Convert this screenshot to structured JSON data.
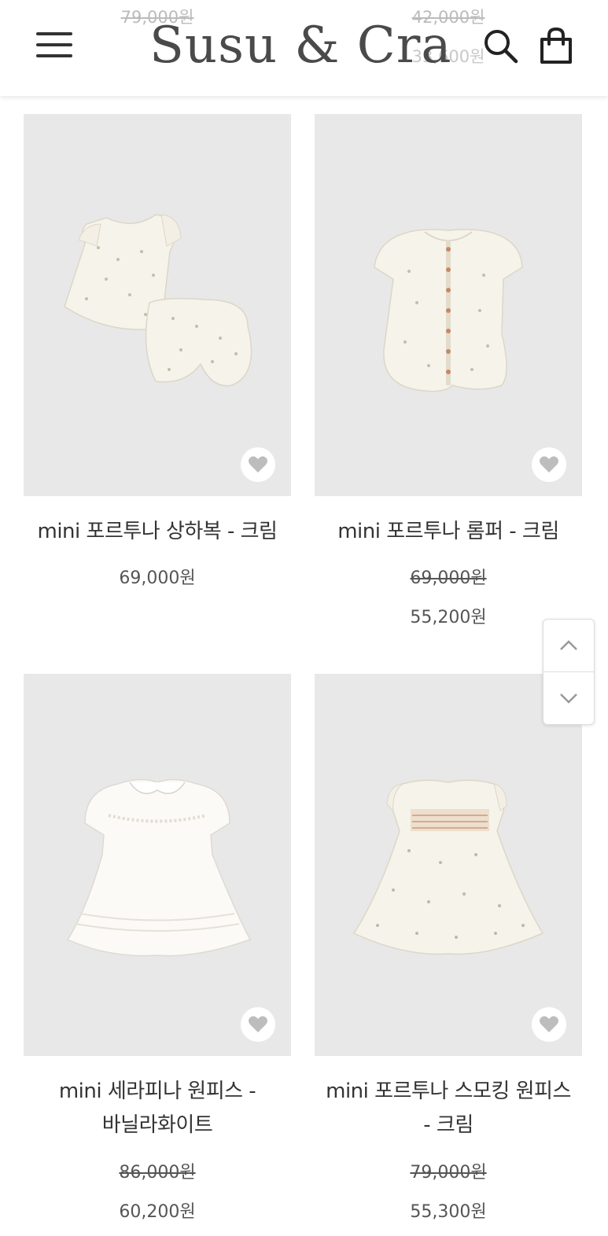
{
  "header": {
    "logo": "Susu & Cra",
    "menu_icon": "hamburger-menu-icon",
    "search_icon": "search-icon",
    "cart_icon": "shopping-bag-icon",
    "peek_left_old_price": "79,000원",
    "peek_right_old_price": "42,000원",
    "peek_right_price": "33,600원"
  },
  "products": [
    {
      "title": "mini 포르투나 상하복 - 크림",
      "price": "69,000원",
      "wishlist_icon": "heart-icon"
    },
    {
      "title": "mini 포르투나 롬퍼 - 크림",
      "original_price": "69,000원",
      "price": "55,200원",
      "wishlist_icon": "heart-icon"
    },
    {
      "title_line1": "mini 세라피나 원피스 -",
      "title_line2": "바닐라화이트",
      "original_price": "86,000원",
      "price": "60,200원",
      "wishlist_icon": "heart-icon"
    },
    {
      "title_line1": "mini 포르투나 스모킹 원피스",
      "title_line2": "- 크림",
      "original_price": "79,000원",
      "price": "55,300원",
      "wishlist_icon": "heart-icon"
    }
  ],
  "scroll_controls": {
    "up_icon": "chevron-up-icon",
    "down_icon": "chevron-down-icon"
  },
  "colors": {
    "header_bg": "#ffffff",
    "image_bg": "#e8e8e8",
    "text": "#333333",
    "price": "#555555"
  }
}
